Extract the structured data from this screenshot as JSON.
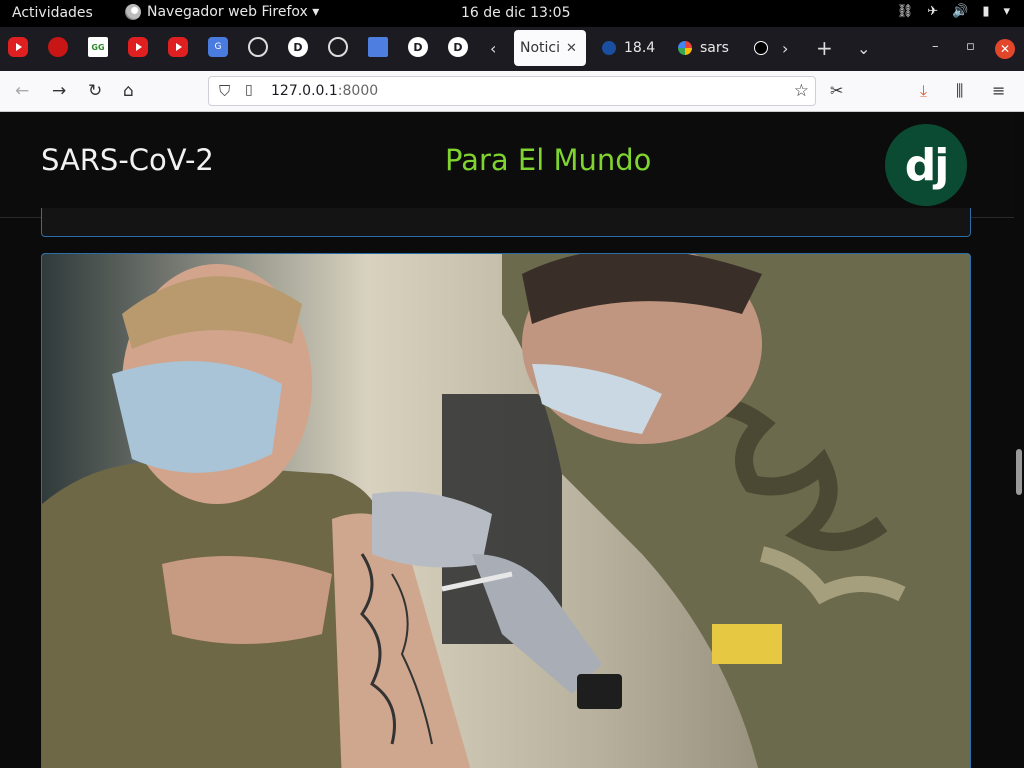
{
  "gnome": {
    "activities": "Actividades",
    "app_menu": "Navegador web Firefox ▾",
    "clock": "16 de dic  13:05"
  },
  "tabs": {
    "active_title": "Notici",
    "tab2_title": "18.4",
    "tab3_title": "sars",
    "close_glyph": "✕"
  },
  "browser": {
    "url_host": "127.0.0.1",
    "url_port": ":8000"
  },
  "site": {
    "title": "SARS-CoV-2",
    "tagline": "Para El Mundo",
    "logo": "dj"
  },
  "colors": {
    "tagline": "#7fd430",
    "logo_bg": "#0c4b33",
    "card_border": "#2c6fa8"
  }
}
